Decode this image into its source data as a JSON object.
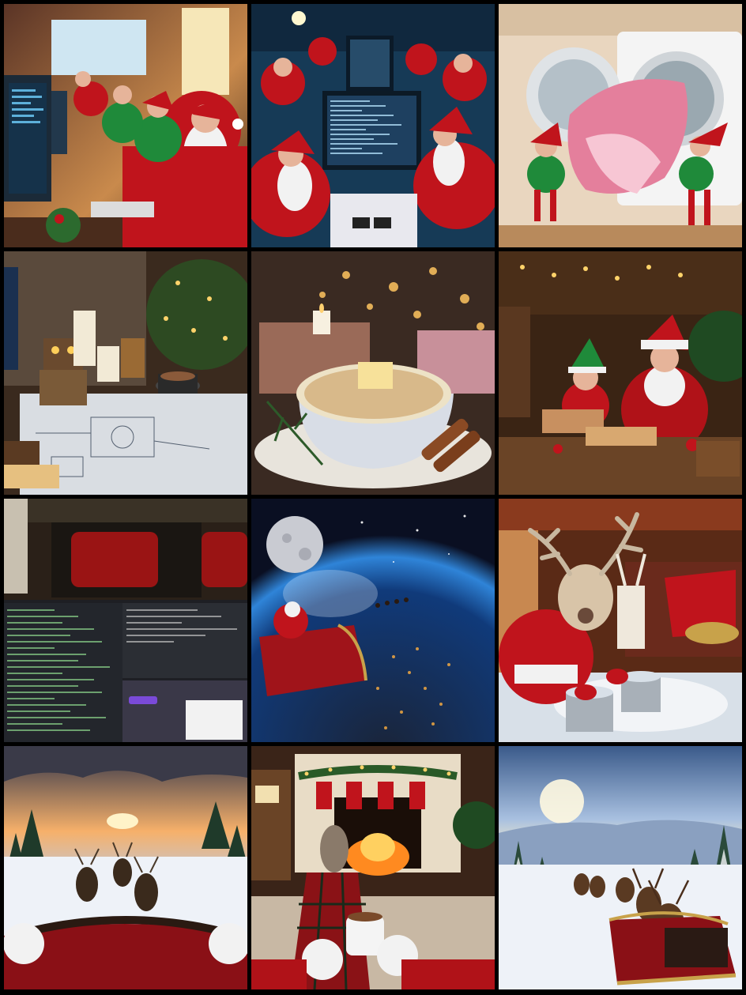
{
  "tiles": [
    {
      "row": 1,
      "col": 1,
      "name": "elves-coding-office",
      "subject": "elves-and-santa-at-computers"
    },
    {
      "row": 1,
      "col": 2,
      "name": "santas-team-at-monitors",
      "subject": "santas-at-computer-desks"
    },
    {
      "row": 1,
      "col": 3,
      "name": "elves-washing-machine",
      "subject": "elves-pulling-pink-blanket-from-washer"
    },
    {
      "row": 2,
      "col": 1,
      "name": "robot-blueprint-desk",
      "subject": "robot-toy-and-blueprint-with-coffee"
    },
    {
      "row": 2,
      "col": 2,
      "name": "rice-pudding-bowl",
      "subject": "rice-pudding-with-butter-and-cinnamon"
    },
    {
      "row": 2,
      "col": 3,
      "name": "santa-elf-workshop",
      "subject": "santa-and-elf-making-toys"
    },
    {
      "row": 3,
      "col": 1,
      "name": "train-laptop-code",
      "subject": "laptop-with-terminal-on-train"
    },
    {
      "row": 3,
      "col": 2,
      "name": "santa-sleigh-over-earth",
      "subject": "santa-sleigh-in-space-above-earth"
    },
    {
      "row": 3,
      "col": 3,
      "name": "reindeer-cleaning",
      "subject": "reindeer-in-santa-suit-with-buckets"
    },
    {
      "row": 4,
      "col": 1,
      "name": "sleigh-ride-pov",
      "subject": "reindeer-pulling-sleigh-pov"
    },
    {
      "row": 4,
      "col": 2,
      "name": "fireplace-cocoa",
      "subject": "feet-by-fireplace-with-cocoa"
    },
    {
      "row": 4,
      "col": 3,
      "name": "sleigh-snowy-valley",
      "subject": "reindeer-sleigh-snowy-landscape"
    }
  ],
  "colors": {
    "background": "#000000",
    "santa_red": "#c0141c",
    "elf_green": "#1f8a3a",
    "snow": "#f2f4f7",
    "night": "#0b1a3a"
  }
}
